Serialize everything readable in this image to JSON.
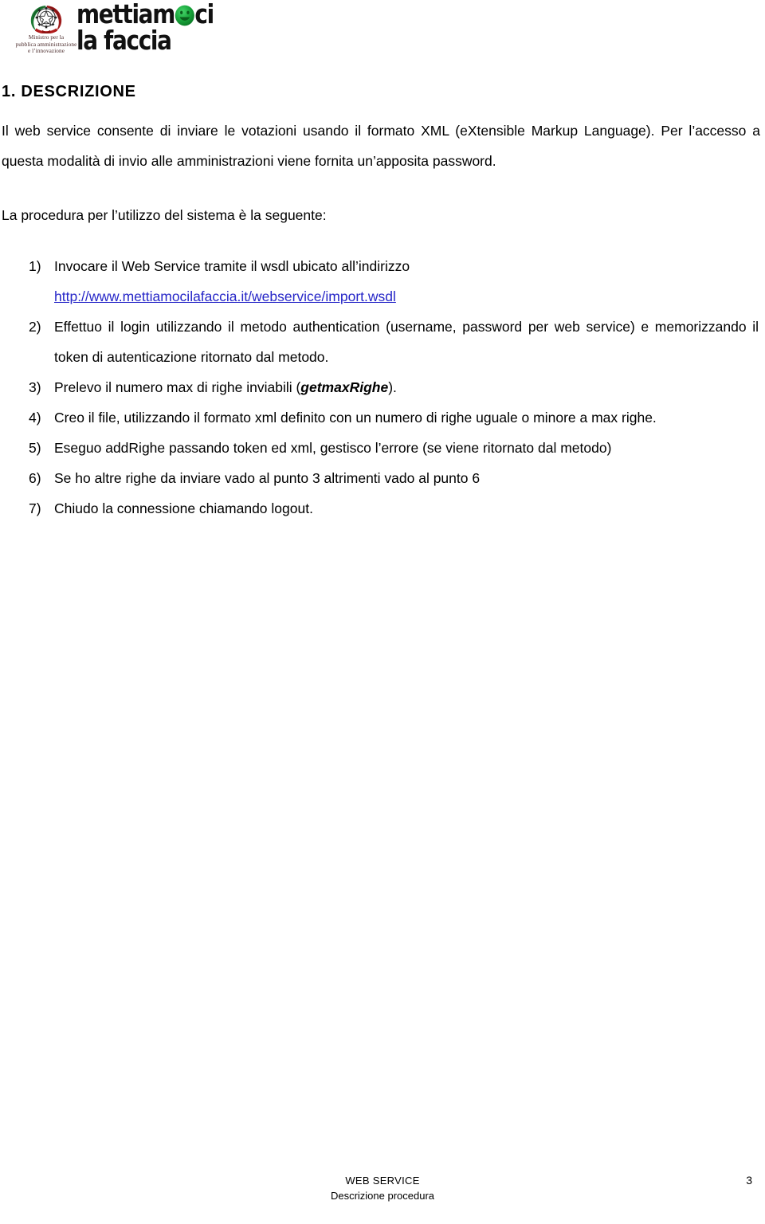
{
  "header": {
    "emblem_alt": "emblema-repubblica-italiana",
    "ministry_text": "Ministro per la\npubblica amministrazione\ne l’innovazione",
    "brand_line1_a": "mettiam",
    "brand_line1_b": "ci",
    "brand_line2": "la faccia",
    "smiley_color": "#17a63b",
    "smiley_face_color": "#0d7a28"
  },
  "document": {
    "section_number_title": "1. DESCRIZIONE",
    "paragraph_1": "Il web service consente di inviare le votazioni usando il formato XML (eXtensible Markup Language). Per l’accesso a questa modalità di invio alle amministrazioni viene fornita un’apposita password.",
    "paragraph_2": "La procedura per l’utilizzo del sistema è la seguente:",
    "steps": [
      {
        "marker": "1)",
        "text": "Invocare il Web Service tramite il wsdl ubicato all’indirizzo",
        "link": "http://www.mettiamocilafaccia.it/webservice/import.wsdl"
      },
      {
        "marker": "2)",
        "text": "Effettuo il login utilizzando il metodo authentication (username, password per web service) e memorizzando il token di autenticazione ritornato dal metodo."
      },
      {
        "marker": "3)",
        "text_before": "Prelevo il numero max di righe inviabili (",
        "emphasis": "getmaxRighe",
        "text_after": ")."
      },
      {
        "marker": "4)",
        "text": "Creo il file, utilizzando il formato xml definito con un numero di righe uguale o minore a max righe."
      },
      {
        "marker": "5)",
        "text": "Eseguo addRighe passando token ed xml, gestisco l’errore (se viene ritornato dal metodo)"
      },
      {
        "marker": "6)",
        "text": "Se ho altre righe da inviare vado al punto 3 altrimenti vado al punto 6"
      },
      {
        "marker": "7)",
        "text": "Chiudo la connessione chiamando logout."
      }
    ]
  },
  "footer": {
    "line1": "WEB SERVICE",
    "line2": "Descrizione procedura",
    "page_number": "3"
  },
  "colors": {
    "link": "#2727c8",
    "text": "#000000",
    "ministry_text": "#4a2b2b"
  }
}
